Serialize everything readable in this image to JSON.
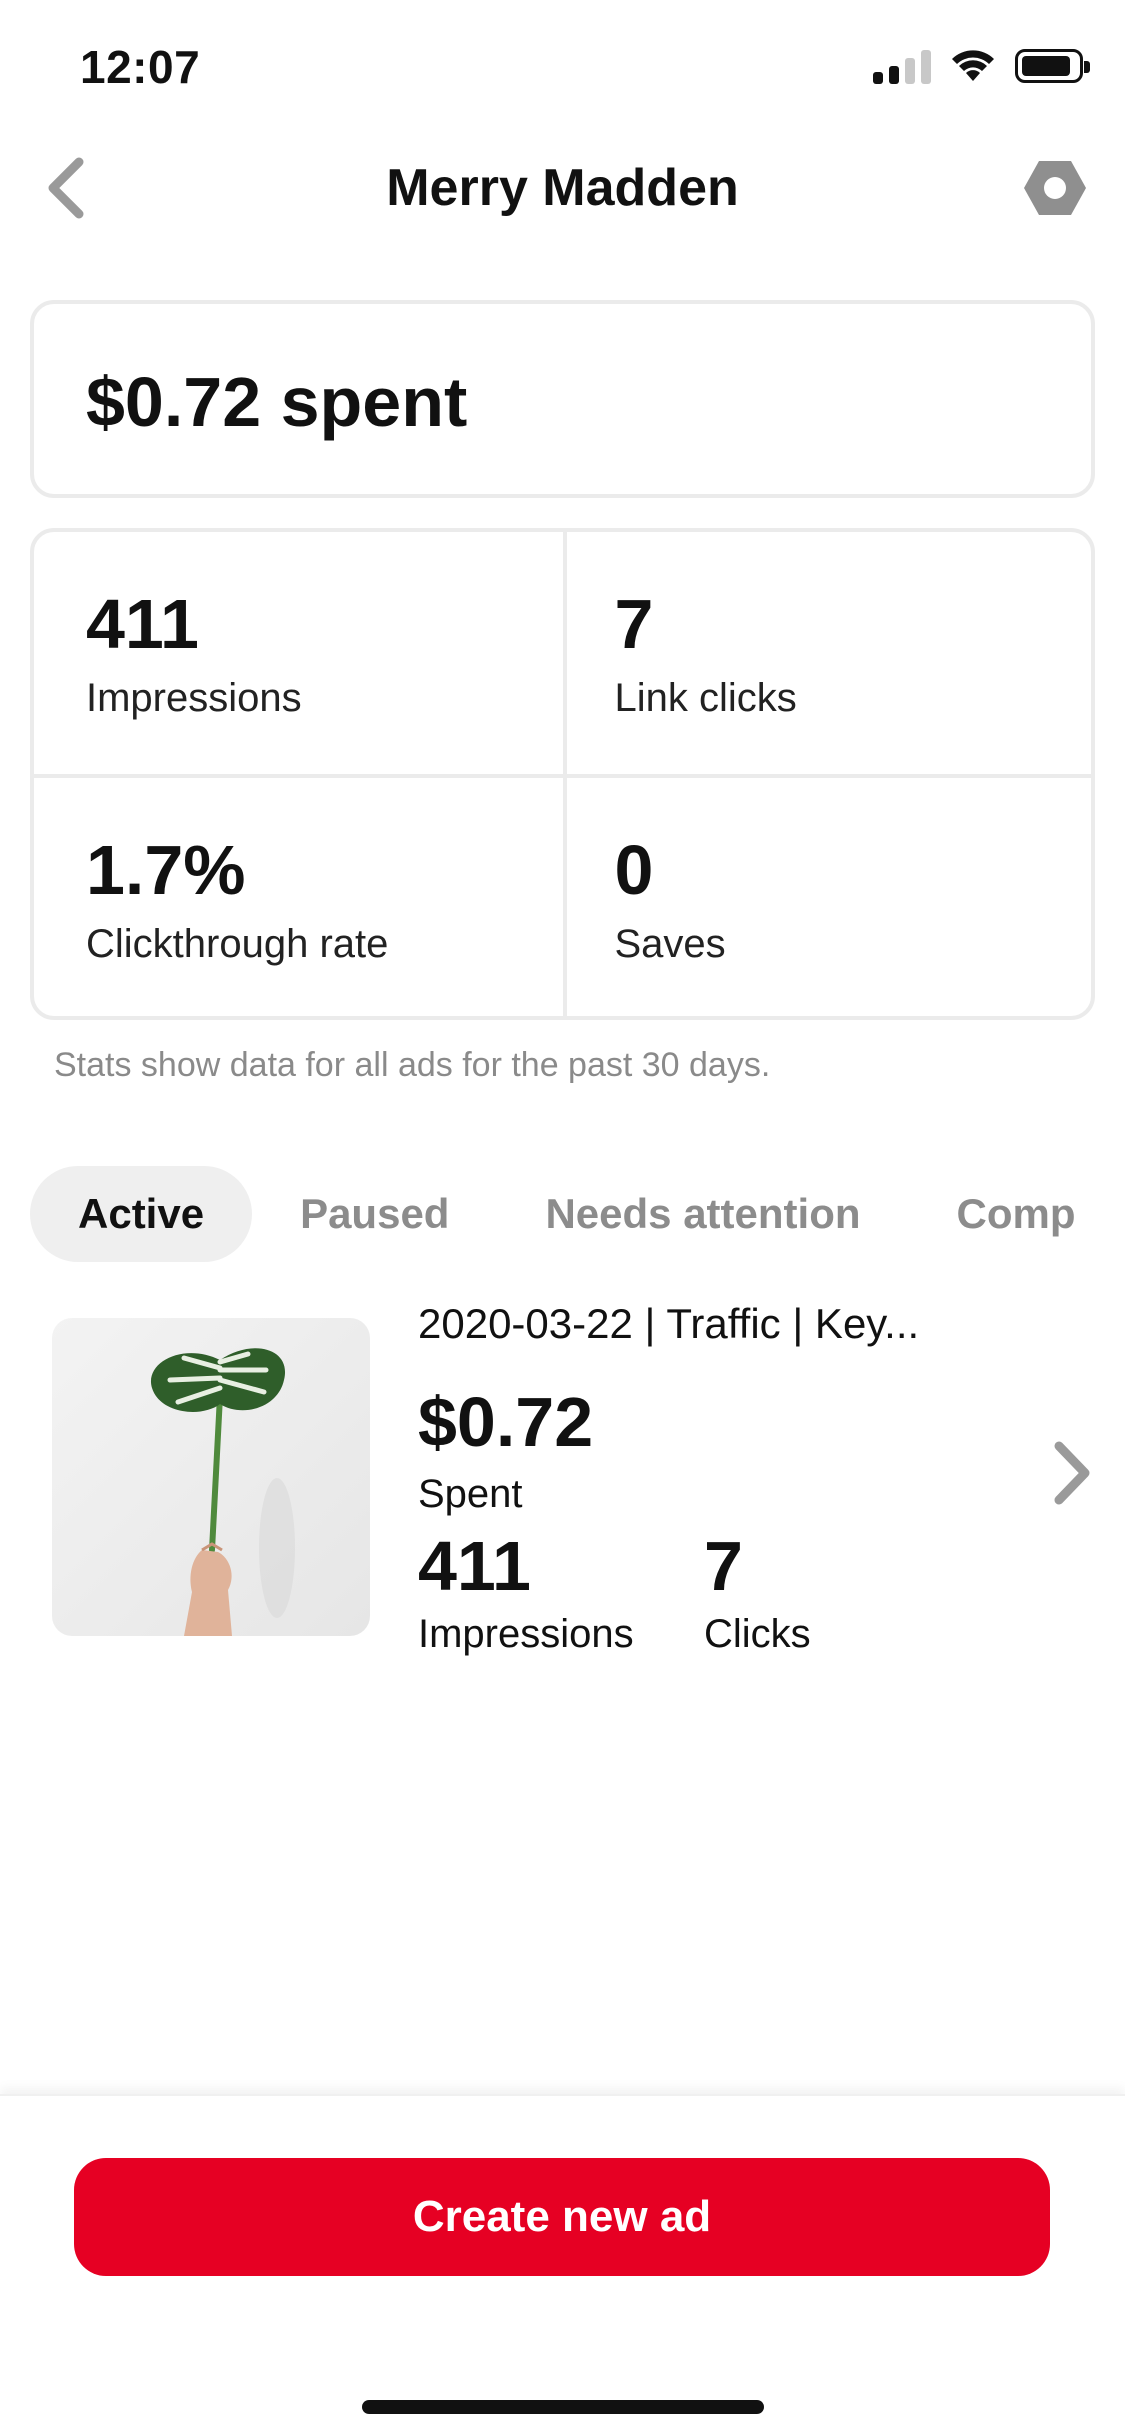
{
  "status_bar": {
    "time": "12:07"
  },
  "header": {
    "title": "Merry Madden",
    "back_icon": "chevron-left-icon",
    "settings_icon": "hexagon-settings-icon"
  },
  "summary": {
    "spent_text": "$0.72 spent"
  },
  "stats": [
    {
      "value": "411",
      "label": "Impressions"
    },
    {
      "value": "7",
      "label": "Link clicks"
    },
    {
      "value": "1.7%",
      "label": "Clickthrough rate"
    },
    {
      "value": "0",
      "label": "Saves"
    }
  ],
  "stats_note": "Stats show data for all ads for the past 30 days.",
  "tabs": [
    {
      "label": "Active",
      "active": true
    },
    {
      "label": "Paused",
      "active": false
    },
    {
      "label": "Needs attention",
      "active": false
    },
    {
      "label": "Comp",
      "active": false
    }
  ],
  "ad": {
    "name": "2020-03-22 | Traffic | Key...",
    "spent_value": "$0.72",
    "spent_label": "Spent",
    "impressions_value": "411",
    "impressions_label": "Impressions",
    "clicks_value": "7",
    "clicks_label": "Clicks"
  },
  "footer": {
    "create_button": "Create new ad"
  },
  "colors": {
    "brand_red": "#e60023",
    "card_border": "#ebebeb",
    "muted_text": "#8a8a8a"
  }
}
